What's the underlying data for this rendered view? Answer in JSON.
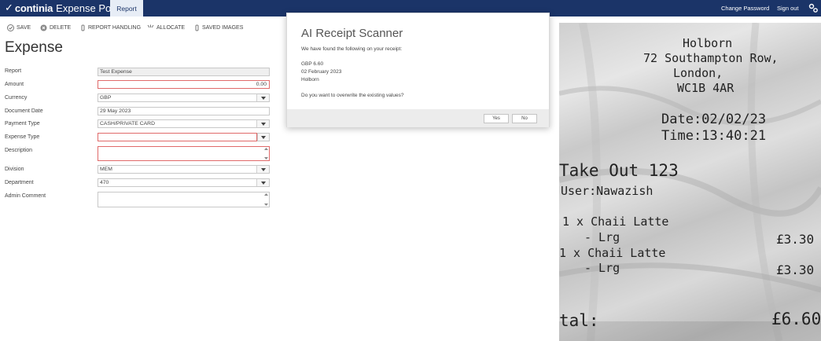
{
  "header": {
    "logo_brand": "continia",
    "logo_portal": "Expense Portal",
    "tab": "Report",
    "change_password": "Change Password",
    "sign_out": "Sign out",
    "brand_color": "#1b3468"
  },
  "toolbar": {
    "save": "SAVE",
    "delete": "DELETE",
    "report_handling": "REPORT HANDLING",
    "allocate": "ALLOCATE",
    "saved_images": "SAVED IMAGES"
  },
  "form": {
    "title": "Expense",
    "labels": {
      "report": "Report",
      "amount": "Amount",
      "currency": "Currency",
      "document_date": "Document Date",
      "payment_type": "Payment Type",
      "expense_type": "Expense Type",
      "description": "Description",
      "division": "Division",
      "department": "Department",
      "admin_comment": "Admin Comment"
    },
    "values": {
      "report": "Test Expense",
      "amount": "0.00",
      "currency": "GBP",
      "document_date": "29 May 2023",
      "payment_type": "CASH/PRIVATE CARD",
      "expense_type": "",
      "description": "",
      "division": "MEM",
      "department": "470",
      "admin_comment": ""
    }
  },
  "modal": {
    "title": "AI Receipt Scanner",
    "intro": "We have found the following on your receipt:",
    "amount": "GBP 6.60",
    "date": "02 February 2023",
    "merchant": "Holborn",
    "question": "Do you want to overwrite the existing values?",
    "yes": "Yes",
    "no": "No"
  },
  "receipt": {
    "line1": "Holborn",
    "line2": "72 Southampton Row,",
    "line3": "London,",
    "line4": "WC1B 4AR",
    "date": "Date:02/02/23",
    "time": "Time:13:40:21",
    "takeout": "Take Out 123",
    "user": "User:Nawazish",
    "item1": "1 x Chaii Latte",
    "item1_size": "- Lrg",
    "item1_price": "£3.30",
    "item2": "1 x Chaii Latte",
    "item2_size": "- Lrg",
    "item2_price": "£3.30",
    "total_label": "tal:",
    "total": "£6.60"
  }
}
